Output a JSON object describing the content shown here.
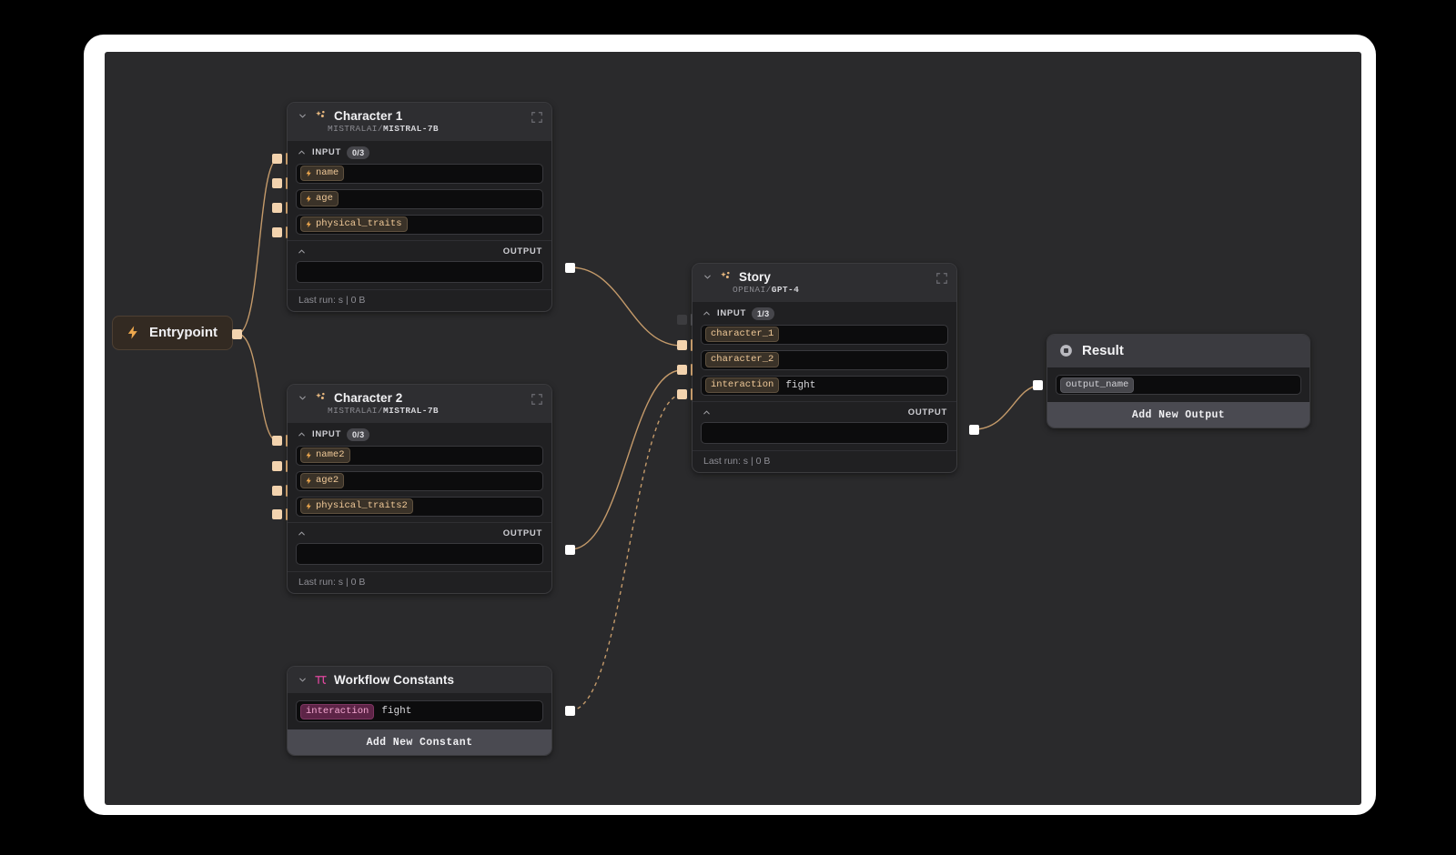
{
  "canvas": {
    "background": "#2a2a2c",
    "frame_color": "#ffffff",
    "accent": "#f3d3ae",
    "edge_color": "#c49a6a"
  },
  "entrypoint": {
    "label": "Entrypoint",
    "icon": "lightning-bolt-icon"
  },
  "nodes": {
    "character1": {
      "title": "Character 1",
      "vendor": "MISTRALAI/",
      "model": "MISTRAL-7B",
      "icon": "sparkles-icon",
      "input_label": "INPUT",
      "input_count": "0/3",
      "fields": [
        {
          "tag": "name",
          "value": ""
        },
        {
          "tag": "age",
          "value": ""
        },
        {
          "tag": "physical_traits",
          "value": ""
        }
      ],
      "output_label": "OUTPUT",
      "footer": "Last run: s | 0 B"
    },
    "character2": {
      "title": "Character 2",
      "vendor": "MISTRALAI/",
      "model": "MISTRAL-7B",
      "icon": "sparkles-icon",
      "input_label": "INPUT",
      "input_count": "0/3",
      "fields": [
        {
          "tag": "name2",
          "value": ""
        },
        {
          "tag": "age2",
          "value": ""
        },
        {
          "tag": "physical_traits2",
          "value": ""
        }
      ],
      "output_label": "OUTPUT",
      "footer": "Last run: s | 0 B"
    },
    "story": {
      "title": "Story",
      "vendor": "OPENAI/",
      "model": "GPT-4",
      "icon": "sparkles-icon",
      "input_label": "INPUT",
      "input_count": "1/3",
      "fields": [
        {
          "tag": "character_1",
          "value": ""
        },
        {
          "tag": "character_2",
          "value": ""
        },
        {
          "tag": "interaction",
          "value": "fight"
        }
      ],
      "output_label": "OUTPUT",
      "footer": "Last run: s | 0 B"
    },
    "constants": {
      "title": "Workflow Constants",
      "icon": "pi-icon",
      "constant": {
        "tag": "interaction",
        "value": "fight"
      },
      "add_button": "Add New Constant"
    },
    "result": {
      "title": "Result",
      "icon": "record-circle-icon",
      "output": {
        "tag": "output_name",
        "value": ""
      },
      "add_button": "Add New Output"
    }
  }
}
